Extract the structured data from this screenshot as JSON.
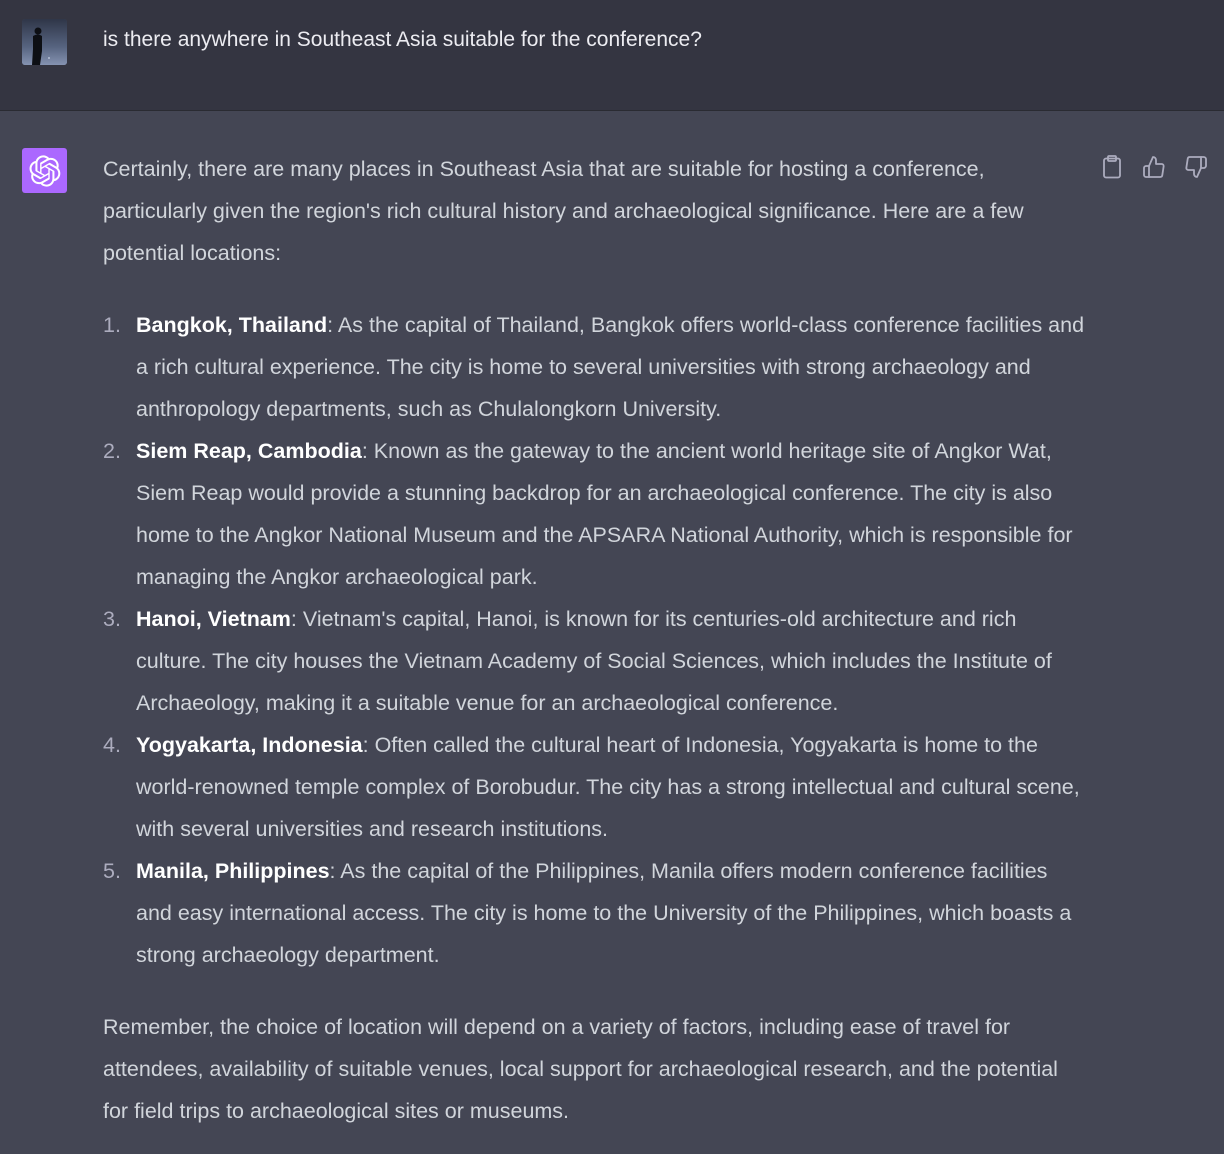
{
  "user_message": {
    "text": "is there anywhere in Southeast Asia suitable for the conference?"
  },
  "assistant_message": {
    "intro": "Certainly, there are many places in Southeast Asia that are suitable for hosting a conference, particularly given the region's rich cultural history and archaeological significance. Here are a few potential locations:",
    "items": [
      {
        "number": "1.",
        "name": "Bangkok, Thailand",
        "description": ": As the capital of Thailand, Bangkok offers world-class conference facilities and a rich cultural experience. The city is home to several universities with strong archaeology and anthropology departments, such as Chulalongkorn University."
      },
      {
        "number": "2.",
        "name": "Siem Reap, Cambodia",
        "description": ": Known as the gateway to the ancient world heritage site of Angkor Wat, Siem Reap would provide a stunning backdrop for an archaeological conference. The city is also home to the Angkor National Museum and the APSARA National Authority, which is responsible for managing the Angkor archaeological park."
      },
      {
        "number": "3.",
        "name": "Hanoi, Vietnam",
        "description": ": Vietnam's capital, Hanoi, is known for its centuries-old architecture and rich culture. The city houses the Vietnam Academy of Social Sciences, which includes the Institute of Archaeology, making it a suitable venue for an archaeological conference."
      },
      {
        "number": "4.",
        "name": "Yogyakarta, Indonesia",
        "description": ": Often called the cultural heart of Indonesia, Yogyakarta is home to the world-renowned temple complex of Borobudur. The city has a strong intellectual and cultural scene, with several universities and research institutions."
      },
      {
        "number": "5.",
        "name": "Manila, Philippines",
        "description": ": As the capital of the Philippines, Manila offers modern conference facilities and easy international access. The city is home to the University of the Philippines, which boasts a strong archaeology department."
      }
    ],
    "conclusion": "Remember, the choice of location will depend on a variety of factors, including ease of travel for attendees, availability of suitable venues, local support for archaeological research, and the potential for field trips to archaeological sites or museums."
  },
  "icons": {
    "user_avatar": "user-avatar-photo",
    "assistant_avatar": "openai-logo-icon",
    "copy": "clipboard-icon",
    "like": "thumbs-up-icon",
    "dislike": "thumbs-down-icon"
  },
  "colors": {
    "user_bg": "#343541",
    "assistant_bg": "#444654",
    "assistant_avatar_bg": "#ab68ff",
    "text": "#d1d5db",
    "bold_text": "#ffffff"
  }
}
